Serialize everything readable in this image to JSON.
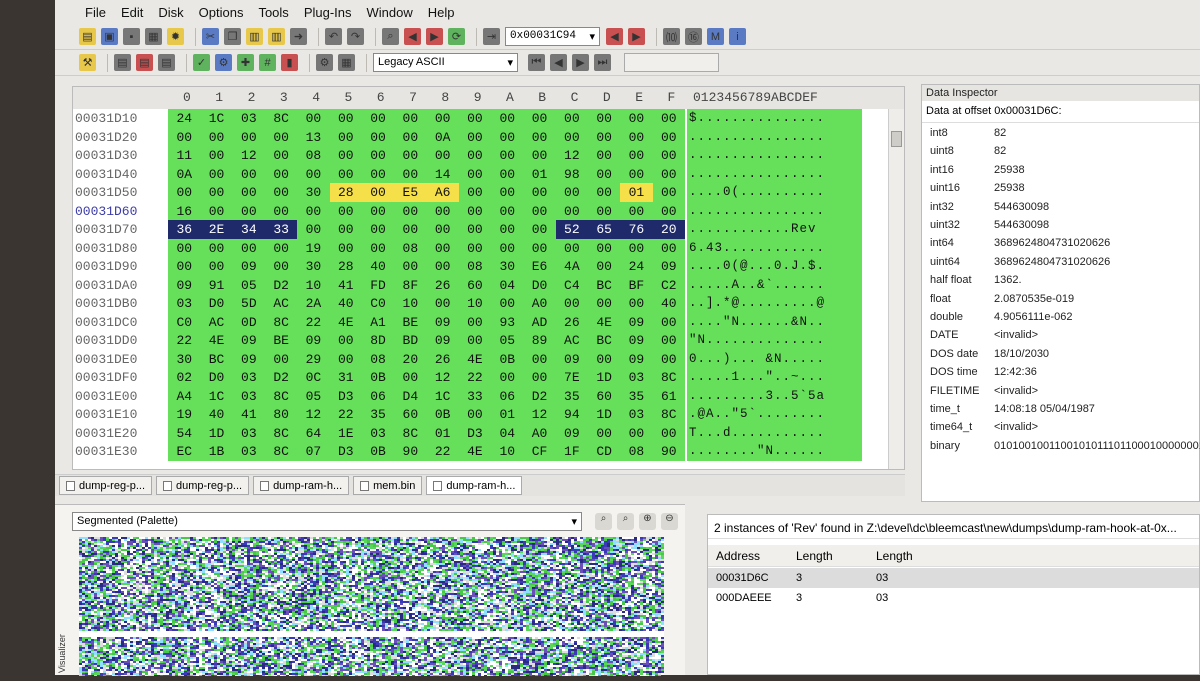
{
  "menu": [
    "File",
    "Edit",
    "Disk",
    "Options",
    "Tools",
    "Plug-Ins",
    "Window",
    "Help"
  ],
  "toolbar": {
    "offset_value": "0x00031C94",
    "encoding": "Legacy ASCII"
  },
  "hex": {
    "column_header": [
      "0",
      "1",
      "2",
      "3",
      "4",
      "5",
      "6",
      "7",
      "8",
      "9",
      "A",
      "B",
      "C",
      "D",
      "E",
      "F"
    ],
    "ascii_header": "0123456789ABCDEF",
    "rows": [
      {
        "addr": "00031D10",
        "bytes": [
          "24",
          "1C",
          "03",
          "8C",
          "00",
          "00",
          "00",
          "00",
          "00",
          "00",
          "00",
          "00",
          "00",
          "00",
          "00",
          "00"
        ],
        "ascii": "$..............."
      },
      {
        "addr": "00031D20",
        "bytes": [
          "00",
          "00",
          "00",
          "00",
          "13",
          "00",
          "00",
          "00",
          "0A",
          "00",
          "00",
          "00",
          "00",
          "00",
          "00",
          "00"
        ],
        "ascii": "................"
      },
      {
        "addr": "00031D30",
        "bytes": [
          "11",
          "00",
          "12",
          "00",
          "08",
          "00",
          "00",
          "00",
          "00",
          "00",
          "00",
          "00",
          "12",
          "00",
          "00",
          "00"
        ],
        "ascii": "................"
      },
      {
        "addr": "00031D40",
        "bytes": [
          "0A",
          "00",
          "00",
          "00",
          "00",
          "00",
          "00",
          "00",
          "14",
          "00",
          "00",
          "01",
          "98",
          "00",
          "00",
          "00"
        ],
        "ascii": "................"
      },
      {
        "addr": "00031D50",
        "bytes": [
          "00",
          "00",
          "00",
          "00",
          "30",
          "28",
          "00",
          "E5",
          "A6",
          "00",
          "00",
          "00",
          "00",
          "00",
          "01",
          "00"
        ],
        "ascii": "....0(.........."
      },
      {
        "addr": "00031D60",
        "bytes": [
          "16",
          "00",
          "00",
          "00",
          "00",
          "00",
          "00",
          "00",
          "00",
          "00",
          "00",
          "00",
          "00",
          "00",
          "00",
          "00"
        ],
        "ascii": "................"
      },
      {
        "addr": "00031D70",
        "bytes": [
          "36",
          "2E",
          "34",
          "33",
          "00",
          "00",
          "00",
          "00",
          "00",
          "00",
          "00",
          "00",
          "52",
          "65",
          "76",
          "20"
        ],
        "ascii": "............Rev "
      },
      {
        "addr": "00031D80",
        "bytes": [
          "00",
          "00",
          "00",
          "00",
          "19",
          "00",
          "00",
          "08",
          "00",
          "00",
          "00",
          "00",
          "00",
          "00",
          "00",
          "00"
        ],
        "ascii": "6.43............"
      },
      {
        "addr": "00031D90",
        "bytes": [
          "00",
          "00",
          "09",
          "00",
          "30",
          "28",
          "40",
          "00",
          "00",
          "08",
          "30",
          "E6",
          "4A",
          "00",
          "24",
          "09"
        ],
        "ascii": "....0(@...0.J.$."
      },
      {
        "addr": "00031DA0",
        "bytes": [
          "09",
          "91",
          "05",
          "D2",
          "10",
          "41",
          "FD",
          "8F",
          "26",
          "60",
          "04",
          "D0",
          "C4",
          "BC",
          "BF",
          "C2"
        ],
        "ascii": ".....A..&`......"
      },
      {
        "addr": "00031DB0",
        "bytes": [
          "03",
          "D0",
          "5D",
          "AC",
          "2A",
          "40",
          "C0",
          "10",
          "00",
          "10",
          "00",
          "A0",
          "00",
          "00",
          "00",
          "40"
        ],
        "ascii": "..].*@.........@"
      },
      {
        "addr": "00031DC0",
        "bytes": [
          "C0",
          "AC",
          "0D",
          "8C",
          "22",
          "4E",
          "A1",
          "BE",
          "09",
          "00",
          "93",
          "AD",
          "26",
          "4E",
          "09",
          "00"
        ],
        "ascii": "....\"N......&N.."
      },
      {
        "addr": "00031DD0",
        "bytes": [
          "22",
          "4E",
          "09",
          "BE",
          "09",
          "00",
          "8D",
          "BD",
          "09",
          "00",
          "05",
          "89",
          "AC",
          "BC",
          "09",
          "00"
        ],
        "ascii": "\"N.............."
      },
      {
        "addr": "00031DE0",
        "bytes": [
          "30",
          "BC",
          "09",
          "00",
          "29",
          "00",
          "08",
          "20",
          "26",
          "4E",
          "0B",
          "00",
          "09",
          "00",
          "09",
          "00"
        ],
        "ascii": "0...)... &N....."
      },
      {
        "addr": "00031DF0",
        "bytes": [
          "02",
          "D0",
          "03",
          "D2",
          "0C",
          "31",
          "0B",
          "00",
          "12",
          "22",
          "00",
          "00",
          "7E",
          "1D",
          "03",
          "8C"
        ],
        "ascii": ".....1...\"..~..."
      },
      {
        "addr": "00031E00",
        "bytes": [
          "A4",
          "1C",
          "03",
          "8C",
          "05",
          "D3",
          "06",
          "D4",
          "1C",
          "33",
          "06",
          "D2",
          "35",
          "60",
          "35",
          "61"
        ],
        "ascii": ".........3..5`5a"
      },
      {
        "addr": "00031E10",
        "bytes": [
          "19",
          "40",
          "41",
          "80",
          "12",
          "22",
          "35",
          "60",
          "0B",
          "00",
          "01",
          "12",
          "94",
          "1D",
          "03",
          "8C"
        ],
        "ascii": ".@A..\"5`........"
      },
      {
        "addr": "00031E20",
        "bytes": [
          "54",
          "1D",
          "03",
          "8C",
          "64",
          "1E",
          "03",
          "8C",
          "01",
          "D3",
          "04",
          "A0",
          "09",
          "00",
          "00",
          "00"
        ],
        "ascii": "T...d..........."
      },
      {
        "addr": "00031E30",
        "bytes": [
          "EC",
          "1B",
          "03",
          "8C",
          "07",
          "D3",
          "0B",
          "90",
          "22",
          "4E",
          "10",
          "CF",
          "1F",
          "CD",
          "08",
          "90"
        ],
        "ascii": "........\"N......"
      }
    ]
  },
  "inspector": {
    "title": "Data Inspector",
    "subtitle": "Data at offset 0x00031D6C:",
    "items": [
      {
        "k": "int8",
        "v": "82"
      },
      {
        "k": "uint8",
        "v": "82"
      },
      {
        "k": "int16",
        "v": "25938"
      },
      {
        "k": "uint16",
        "v": "25938"
      },
      {
        "k": "int32",
        "v": "544630098"
      },
      {
        "k": "uint32",
        "v": "544630098"
      },
      {
        "k": "int64",
        "v": "3689624804731020626"
      },
      {
        "k": "uint64",
        "v": "3689624804731020626"
      },
      {
        "k": "half float",
        "v": "1362."
      },
      {
        "k": "float",
        "v": "2.0870535e-019"
      },
      {
        "k": "double",
        "v": "4.9056111e-062"
      },
      {
        "k": "DATE",
        "v": "<invalid>"
      },
      {
        "k": "DOS date",
        "v": "18/10/2030"
      },
      {
        "k": "DOS time",
        "v": "12:42:36"
      },
      {
        "k": "FILETIME",
        "v": "<invalid>"
      },
      {
        "k": "time_t",
        "v": "14:08:18 05/04/1987"
      },
      {
        "k": "time64_t",
        "v": "<invalid>"
      },
      {
        "k": "binary",
        "v": "01010010011001010111011000100000001"
      }
    ]
  },
  "tabs": [
    "dump-reg-p...",
    "dump-reg-p...",
    "dump-ram-h...",
    "mem.bin",
    "dump-ram-h..."
  ],
  "visualizer": {
    "mode": "Segmented (Palette)",
    "label": "Visualizer"
  },
  "find": {
    "title": "2 instances of 'Rev' found in Z:\\devel\\dc\\bleemcast\\new\\dumps\\dump-ram-hook-at-0x...",
    "headers": [
      "Address",
      "Length",
      "Length"
    ],
    "rows": [
      {
        "address": "00031D6C",
        "len": "3",
        "len2": "03"
      },
      {
        "address": "000DAEEE",
        "len": "3",
        "len2": "03"
      }
    ]
  }
}
